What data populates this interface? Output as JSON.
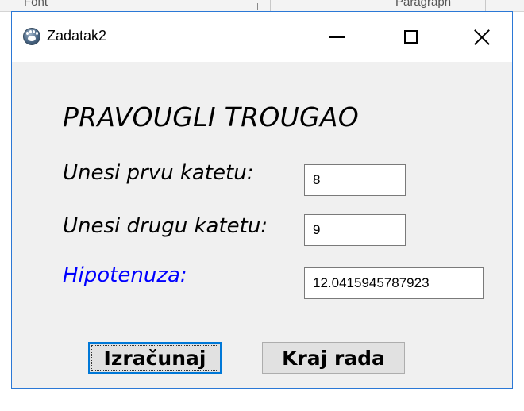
{
  "background_app": {
    "font_group": "Font",
    "paragraph_group": "Paragraph"
  },
  "window": {
    "title": "Zadatak2",
    "icon": "paw-icon",
    "controls": [
      "minimize-icon",
      "maximize-icon",
      "close-icon"
    ]
  },
  "form": {
    "heading": "PRAVOUGLI TROUGAO",
    "first_leg_label": "Unesi prvu katetu:",
    "first_leg_value": "8",
    "second_leg_label": "Unesi drugu katetu:",
    "second_leg_value": "9",
    "hypotenuse_label": "Hipotenuza:",
    "hypotenuse_value": "12.0415945787923"
  },
  "buttons": {
    "calculate": "Izračunaj",
    "quit": "Kraj rada"
  },
  "colors": {
    "hypotenuse_label": "#0000ff",
    "focus_border": "#0078d7",
    "window_border": "#2b78d6"
  }
}
